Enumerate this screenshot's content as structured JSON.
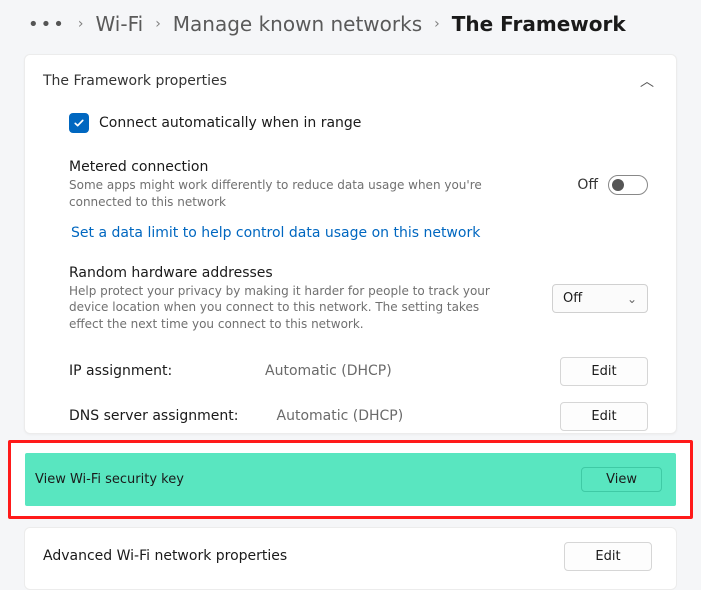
{
  "breadcrumb": {
    "items": [
      "Wi-Fi",
      "Manage known networks"
    ],
    "current": "The Framework"
  },
  "panel": {
    "title": "The Framework properties",
    "auto_connect_label": "Connect automatically when in range",
    "metered": {
      "title": "Metered connection",
      "subtitle": "Some apps might work differently to reduce data usage when you're connected to this network",
      "toggle_label": "Off"
    },
    "data_limit_link": "Set a data limit to help control data usage on this network",
    "random_hw": {
      "title": "Random hardware addresses",
      "subtitle": "Help protect your privacy by making it harder for people to track your device location when you connect to this network. The setting takes effect the next time you connect to this network.",
      "dropdown_value": "Off"
    },
    "ip_assignment": {
      "key": "IP assignment:",
      "value": "Automatic (DHCP)",
      "button": "Edit"
    },
    "dns_assignment": {
      "key": "DNS server assignment:",
      "value": "Automatic (DHCP)",
      "button": "Edit"
    }
  },
  "security_key": {
    "label": "View Wi-Fi security key",
    "button": "View"
  },
  "advanced": {
    "label": "Advanced Wi-Fi network properties",
    "button": "Edit"
  }
}
